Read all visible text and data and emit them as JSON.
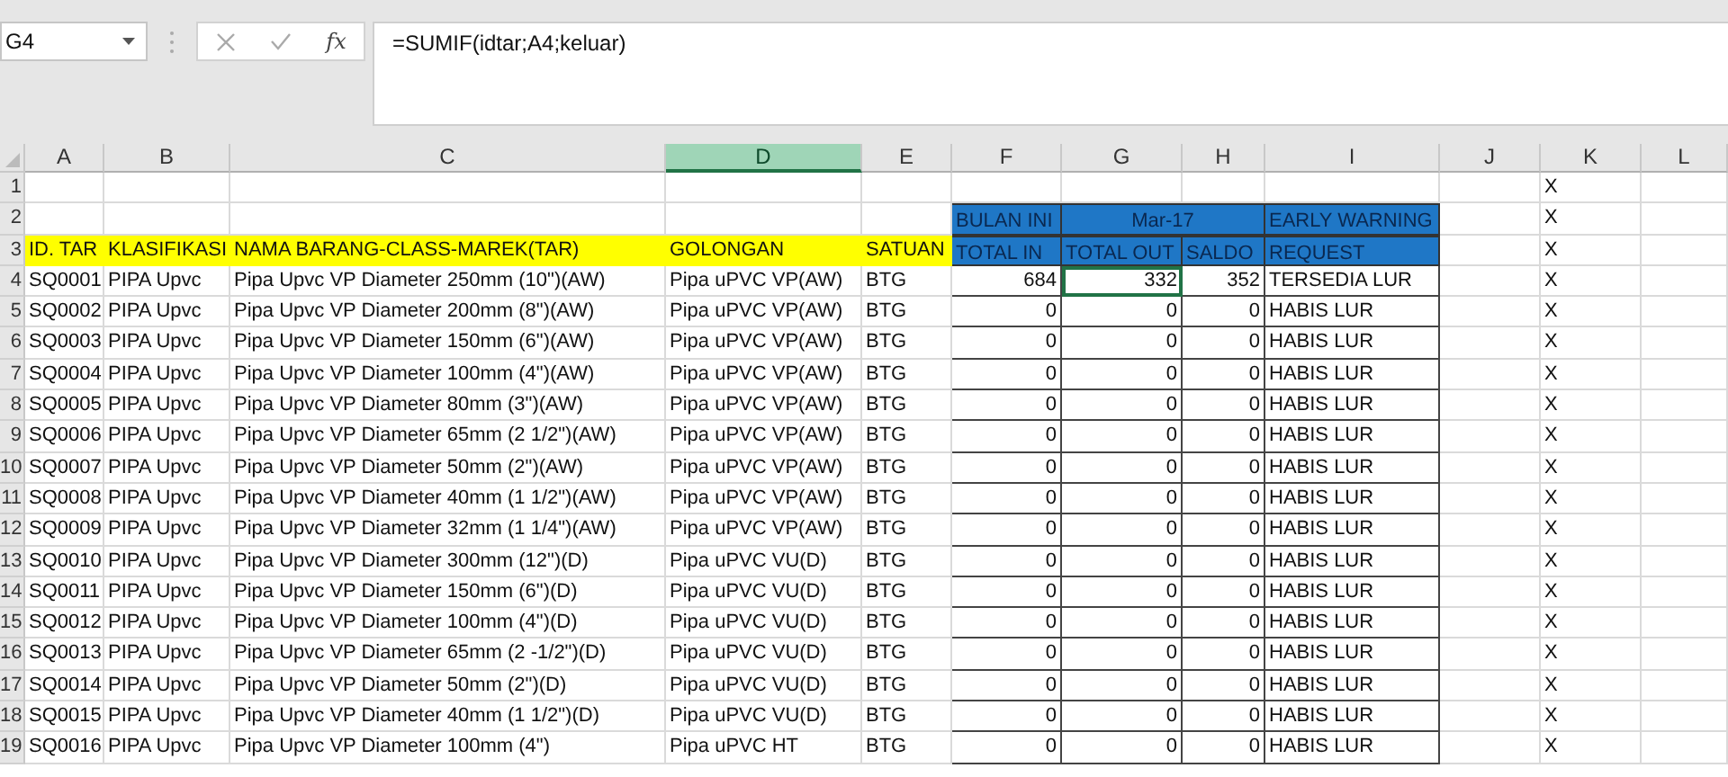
{
  "name_box": "G4",
  "formula_buttons": {
    "fx": "fx"
  },
  "formula": "=SUMIF(idtar;A4;keluar)",
  "columns": [
    {
      "letter": "A",
      "selected": false
    },
    {
      "letter": "B",
      "selected": false
    },
    {
      "letter": "C",
      "selected": false
    },
    {
      "letter": "D",
      "selected": true
    },
    {
      "letter": "E",
      "selected": false
    },
    {
      "letter": "F",
      "selected": false
    },
    {
      "letter": "G",
      "selected": false
    },
    {
      "letter": "H",
      "selected": false
    },
    {
      "letter": "I",
      "selected": false
    },
    {
      "letter": "J",
      "selected": false
    },
    {
      "letter": "K",
      "selected": false
    },
    {
      "letter": "L",
      "selected": false
    }
  ],
  "rows": [
    {
      "number": "1",
      "kind": "blank",
      "mark": "X"
    },
    {
      "number": "2",
      "kind": "band",
      "bulan": "BULAN INI",
      "month": "Mar-17",
      "warning": "EARLY WARNING",
      "mark": "X"
    },
    {
      "number": "3",
      "kind": "header",
      "labels": [
        "ID. TAR",
        "KLASIFIKASI",
        "NAMA BARANG-CLASS-MAREK(TAR)",
        "GOLONGAN",
        "SATUAN"
      ],
      "bands": [
        "TOTAL IN",
        "TOTAL OUT",
        "SALDO",
        "REQUEST"
      ],
      "mark": "X"
    },
    {
      "number": "4",
      "kind": "data",
      "id": "SQ0001",
      "class": "PIPA Upvc",
      "name": "Pipa Upvc VP Diameter 250mm (10\")(AW)",
      "group": "Pipa uPVC VP(AW)",
      "unit": "BTG",
      "total_in": "684",
      "total_out": "332",
      "out_selected": true,
      "saldo": "352",
      "request": "TERSEDIA LUR",
      "mark": "X"
    },
    {
      "number": "5",
      "kind": "data",
      "id": "SQ0002",
      "class": "PIPA Upvc",
      "name": "Pipa Upvc VP Diameter 200mm (8\")(AW)",
      "group": "Pipa uPVC VP(AW)",
      "unit": "BTG",
      "total_in": "0",
      "total_out": "0",
      "out_selected": false,
      "saldo": "0",
      "request": "HABIS LUR",
      "mark": "X"
    },
    {
      "number": "6",
      "kind": "data",
      "id": "SQ0003",
      "class": "PIPA Upvc",
      "name": "Pipa Upvc VP Diameter 150mm (6\")(AW)",
      "group": "Pipa uPVC VP(AW)",
      "unit": "BTG",
      "total_in": "0",
      "total_out": "0",
      "out_selected": false,
      "saldo": "0",
      "request": "HABIS LUR",
      "mark": "X"
    },
    {
      "number": "7",
      "kind": "data",
      "id": "SQ0004",
      "class": "PIPA Upvc",
      "name": "Pipa Upvc VP Diameter 100mm (4\")(AW)",
      "group": "Pipa uPVC VP(AW)",
      "unit": "BTG",
      "total_in": "0",
      "total_out": "0",
      "out_selected": false,
      "saldo": "0",
      "request": "HABIS LUR",
      "mark": "X"
    },
    {
      "number": "8",
      "kind": "data",
      "id": "SQ0005",
      "class": "PIPA Upvc",
      "name": "Pipa Upvc VP Diameter 80mm (3\")(AW)",
      "group": "Pipa uPVC VP(AW)",
      "unit": "BTG",
      "total_in": "0",
      "total_out": "0",
      "out_selected": false,
      "saldo": "0",
      "request": "HABIS LUR",
      "mark": "X"
    },
    {
      "number": "9",
      "kind": "data",
      "id": "SQ0006",
      "class": "PIPA Upvc",
      "name": "Pipa Upvc VP Diameter 65mm (2 1/2\")(AW)",
      "group": "Pipa uPVC VP(AW)",
      "unit": "BTG",
      "total_in": "0",
      "total_out": "0",
      "out_selected": false,
      "saldo": "0",
      "request": "HABIS LUR",
      "mark": "X"
    },
    {
      "number": "10",
      "kind": "data",
      "id": "SQ0007",
      "class": "PIPA Upvc",
      "name": "Pipa Upvc VP Diameter 50mm (2\")(AW)",
      "group": "Pipa uPVC VP(AW)",
      "unit": "BTG",
      "total_in": "0",
      "total_out": "0",
      "out_selected": false,
      "saldo": "0",
      "request": "HABIS LUR",
      "mark": "X"
    },
    {
      "number": "11",
      "kind": "data",
      "id": "SQ0008",
      "class": "PIPA Upvc",
      "name": "Pipa Upvc VP Diameter 40mm (1 1/2\")(AW)",
      "group": "Pipa uPVC VP(AW)",
      "unit": "BTG",
      "total_in": "0",
      "total_out": "0",
      "out_selected": false,
      "saldo": "0",
      "request": "HABIS LUR",
      "mark": "X"
    },
    {
      "number": "12",
      "kind": "data",
      "id": "SQ0009",
      "class": "PIPA Upvc",
      "name": "Pipa Upvc VP Diameter 32mm (1 1/4\")(AW)",
      "group": "Pipa uPVC VP(AW)",
      "unit": "BTG",
      "total_in": "0",
      "total_out": "0",
      "out_selected": false,
      "saldo": "0",
      "request": "HABIS LUR",
      "mark": "X"
    },
    {
      "number": "13",
      "kind": "data",
      "id": "SQ0010",
      "class": "PIPA Upvc",
      "name": "Pipa Upvc VP Diameter 300mm (12\")(D)",
      "group": "Pipa uPVC VU(D)",
      "unit": "BTG",
      "total_in": "0",
      "total_out": "0",
      "out_selected": false,
      "saldo": "0",
      "request": "HABIS LUR",
      "mark": "X"
    },
    {
      "number": "14",
      "kind": "data",
      "id": "SQ0011",
      "class": "PIPA Upvc",
      "name": "Pipa Upvc VP Diameter 150mm (6\")(D)",
      "group": "Pipa uPVC VU(D)",
      "unit": "BTG",
      "total_in": "0",
      "total_out": "0",
      "out_selected": false,
      "saldo": "0",
      "request": "HABIS LUR",
      "mark": "X"
    },
    {
      "number": "15",
      "kind": "data",
      "id": "SQ0012",
      "class": "PIPA Upvc",
      "name": "Pipa Upvc VP Diameter 100mm (4\")(D)",
      "group": "Pipa uPVC VU(D)",
      "unit": "BTG",
      "total_in": "0",
      "total_out": "0",
      "out_selected": false,
      "saldo": "0",
      "request": "HABIS LUR",
      "mark": "X"
    },
    {
      "number": "16",
      "kind": "data",
      "id": "SQ0013",
      "class": "PIPA Upvc",
      "name": "Pipa Upvc VP Diameter 65mm (2 -1/2\")(D)",
      "group": "Pipa uPVC VU(D)",
      "unit": "BTG",
      "total_in": "0",
      "total_out": "0",
      "out_selected": false,
      "saldo": "0",
      "request": "HABIS LUR",
      "mark": "X"
    },
    {
      "number": "17",
      "kind": "data",
      "id": "SQ0014",
      "class": "PIPA Upvc",
      "name": "Pipa Upvc VP Diameter 50mm (2\")(D)",
      "group": "Pipa uPVC VU(D)",
      "unit": "BTG",
      "total_in": "0",
      "total_out": "0",
      "out_selected": false,
      "saldo": "0",
      "request": "HABIS LUR",
      "mark": "X"
    },
    {
      "number": "18",
      "kind": "data",
      "id": "SQ0015",
      "class": "PIPA Upvc",
      "name": "Pipa Upvc VP Diameter 40mm (1 1/2\")(D)",
      "group": "Pipa uPVC VU(D)",
      "unit": "BTG",
      "total_in": "0",
      "total_out": "0",
      "out_selected": false,
      "saldo": "0",
      "request": "HABIS LUR",
      "mark": "X"
    },
    {
      "number": "19",
      "kind": "data",
      "id": "SQ0016",
      "class": "PIPA Upvc",
      "name": "Pipa Upvc VP Diameter 100mm (4\")",
      "group": "Pipa uPVC HT",
      "unit": "BTG",
      "total_in": "0",
      "total_out": "0",
      "out_selected": false,
      "saldo": "0",
      "request": "HABIS LUR",
      "mark": "X"
    }
  ]
}
